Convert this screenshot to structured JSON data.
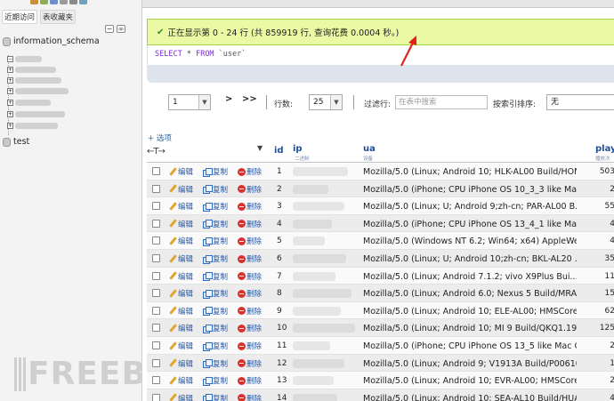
{
  "nav": {
    "tabs": [
      "近期访问",
      "表收藏夹"
    ],
    "databases": [
      "information_schema",
      "test"
    ]
  },
  "status": {
    "message": "正在显示第 0 - 24 行 (共 859919 行, 查询花费 0.0004 秒。)",
    "success_color": "#ebf8a4"
  },
  "sql": {
    "select_kw": "SELECT",
    "star": " * ",
    "from_kw": "FROM",
    "table": " `user`"
  },
  "pager": {
    "page_value": "1",
    "next": ">",
    "last": ">>",
    "rows_label": "行数:",
    "rows_value": "25",
    "filter_label": "过滤行:",
    "filter_placeholder": "在表中搜索",
    "sort_label": "按索引排序:",
    "sort_value": "无"
  },
  "options_link": "+ 选项",
  "table": {
    "nav_arrows": "←T→",
    "headers": {
      "id": "id",
      "ip": "ip",
      "ip_sub": "二进制",
      "ua": "ua",
      "ua_sub": "设备",
      "play": "play",
      "play_sub": "播放次数"
    },
    "actions": {
      "edit": "编辑",
      "copy": "复制",
      "delete": "删除"
    },
    "rows": [
      {
        "id": "1",
        "ua": "Mozilla/5.0 (Linux; Android 10; HLK-AL00 Build/HON...",
        "play": "503"
      },
      {
        "id": "2",
        "ua": "Mozilla/5.0 (iPhone; CPU iPhone OS 10_3_3 like Mac...",
        "play": "2"
      },
      {
        "id": "3",
        "ua": "Mozilla/5.0 (Linux; U; Android 9;zh-cn; PAR-AL00 B...",
        "play": "55"
      },
      {
        "id": "4",
        "ua": "Mozilla/5.0 (iPhone; CPU iPhone OS 13_4_1 like Mac...",
        "play": "4"
      },
      {
        "id": "5",
        "ua": "Mozilla/5.0 (Windows NT 6.2; Win64; x64) AppleWebK...",
        "play": "4"
      },
      {
        "id": "6",
        "ua": "Mozilla/5.0 (Linux; U; Android 10;zh-cn; BKL-AL20 ...",
        "play": "35"
      },
      {
        "id": "7",
        "ua": "Mozilla/5.0 (Linux; Android 7.1.2; vivo X9Plus Bui...",
        "play": "11"
      },
      {
        "id": "8",
        "ua": "Mozilla/5.0 (Linux; Android 6.0; Nexus 5 Build/MRA...",
        "play": "15"
      },
      {
        "id": "9",
        "ua": "Mozilla/5.0 (Linux; Android 10; ELE-AL00; HMSCore ...",
        "play": "62"
      },
      {
        "id": "10",
        "ua": "Mozilla/5.0 (Linux; Android 10; MI 9 Build/QKQ1.19...",
        "play": "125"
      },
      {
        "id": "11",
        "ua": "Mozilla/5.0 (iPhone; CPU iPhone OS 13_5 like Mac O...",
        "play": "2"
      },
      {
        "id": "12",
        "ua": "Mozilla/5.0 (Linux; Android 9; V1913A Build/P00610...",
        "play": "1"
      },
      {
        "id": "13",
        "ua": "Mozilla/5.0 (Linux; Android 10; EVR-AL00; HMSCore ...",
        "play": "2"
      },
      {
        "id": "14",
        "ua": "Mozilla/5.0 (Linux; Android 10; SEA-AL10 Build/HUA...",
        "play": "4"
      }
    ]
  },
  "watermark": "FREEBU"
}
